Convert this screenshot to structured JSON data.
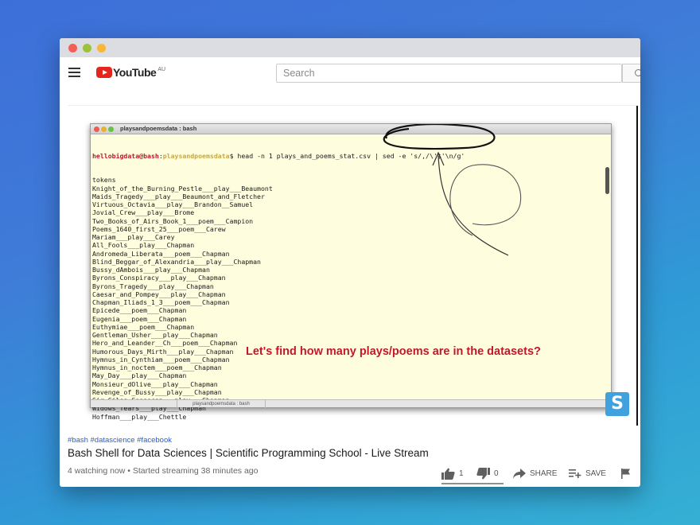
{
  "header": {
    "logo_text": "YouTube",
    "logo_region": "AU",
    "search_placeholder": "Search"
  },
  "terminal": {
    "window_title": "playsandpoemsdata : bash",
    "prompt_user": "hellobigdata@bash",
    "prompt_sep": ":",
    "prompt_path": "playsandpoemsdata",
    "command": "$ head -n 1 plays_and_poems_stat.csv | sed -e 's/,/\\'$'\\n/g'",
    "lines": [
      "tokens",
      "Knight_of_the_Burning_Pestle___play___Beaumont",
      "Maids_Tragedy___play___Beaumont_and_Fletcher",
      "Virtuous_Octavia___play___Brandon__Samuel",
      "Jovial_Crew___play___Brome",
      "Two_Books_of_Airs_Book_1___poem___Campion",
      "Poems_1640_first_25___poem___Carew",
      "Mariam___play___Carey",
      "All_Fools___play___Chapman",
      "Andromeda_Liberata___poem___Chapman",
      "Blind_Beggar_of_Alexandria___play___Chapman",
      "Bussy_dAmbois___play___Chapman",
      "Byrons_Conspiracy___play___Chapman",
      "Byrons_Tragedy___play___Chapman",
      "Caesar_and_Pompey___play___Chapman",
      "Chapman_Iliads_1_3___poem___Chapman",
      "Epicede___poem___Chapman",
      "Eugenia___poem___Chapman",
      "Euthymiae___poem___Chapman",
      "Gentleman_Usher___play___Chapman",
      "Hero_and_Leander__Ch___poem___Chapman",
      "Humorous_Days_Mirth___play___Chapman",
      "Hymnus_in_Cynthiam___poem___Chapman",
      "Hymnus_in_noctem___poem___Chapman",
      "May_Day___play___Chapman",
      "Monsieur_dOlive___play___Chapman",
      "Revenge_of_Bussy___play___Chapman",
      "Sir_Giles_Goosecap___play___Chapman",
      "Widows_Tears___play___Chapman",
      "Hoffman___play___Chettle"
    ],
    "status_tab": "playsandpoemsdata : bash",
    "annotation": "Let's find how many plays/poems are in the datasets?",
    "badge_letter": "S"
  },
  "video": {
    "hashtags": "#bash #datascience #facebook",
    "title": "Bash Shell for Data Sciences | Scientific Programming School - Live Stream",
    "meta": "4 watching now • Started streaming 38 minutes ago",
    "likes": "1",
    "dislikes": "0",
    "share_label": "SHARE",
    "save_label": "SAVE"
  }
}
